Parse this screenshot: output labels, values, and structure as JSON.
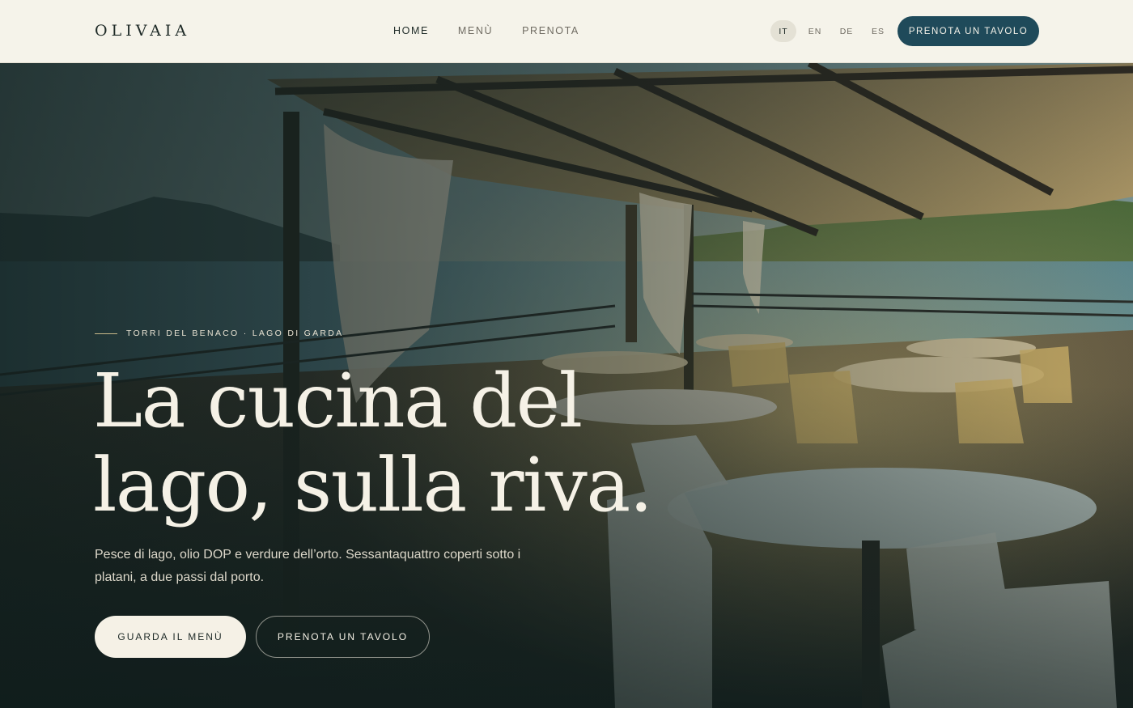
{
  "brand": {
    "logo": "OLIVAIA"
  },
  "nav": {
    "items": [
      {
        "label": "HOME",
        "active": true
      },
      {
        "label": "MENÙ",
        "active": false
      },
      {
        "label": "PRENOTA",
        "active": false
      }
    ]
  },
  "languages": [
    {
      "code": "IT",
      "active": true
    },
    {
      "code": "EN",
      "active": false
    },
    {
      "code": "DE",
      "active": false
    },
    {
      "code": "ES",
      "active": false
    }
  ],
  "header_cta": {
    "label": "PRENOTA UN TAVOLO"
  },
  "hero": {
    "eyebrow": "TORRI DEL BENACO · LAGO DI GARDA",
    "headline_line1": "La cucina del",
    "headline_line2": "lago, sulla riva.",
    "lede": "Pesce di lago, olio DOP e verdure dell’orto. Sessantaquattro coperti sotto i platani, a due passi dal porto.",
    "primary_button": "GUARDA IL MENÙ",
    "secondary_button": "PRENOTA UN TAVOLO"
  },
  "colors": {
    "header_bg": "#f5f3ea",
    "accent": "#1f4a5a",
    "text_dark": "#1e2a27",
    "hero_text": "#f5f1e6"
  }
}
